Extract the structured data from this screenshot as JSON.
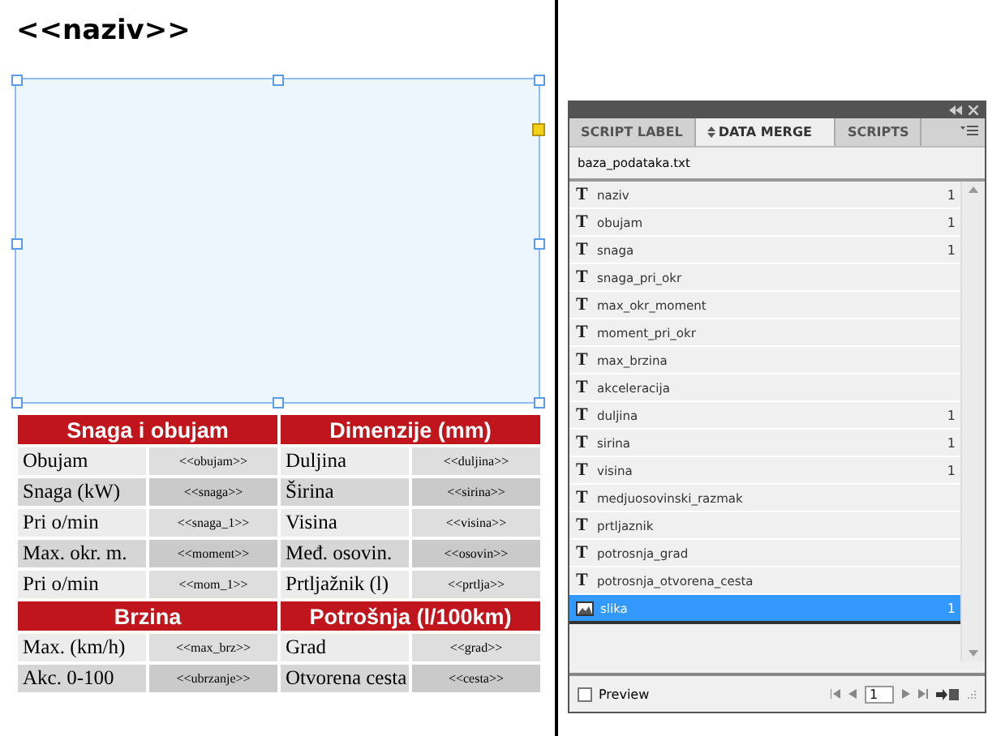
{
  "document": {
    "title": "<<naziv>>",
    "table": {
      "sections": [
        {
          "headers": [
            "Snaga i obujam",
            "Dimenzije (mm)"
          ],
          "rows": [
            [
              "Obujam",
              "<<obujam>>",
              "Duljina",
              "<<duljina>>"
            ],
            [
              "Snaga (kW)",
              "<<snaga>>",
              "Širina",
              "<<sirina>>"
            ],
            [
              "Pri o/min",
              "<<snaga_1>>",
              "Visina",
              "<<visina>>"
            ],
            [
              "Max. okr. m.",
              "<<moment>>",
              "Međ. osovin.",
              "<<osovin>>"
            ],
            [
              "Pri o/min",
              "<<mom_1>>",
              "Prtljažnik (l)",
              "<<prtlja>>"
            ]
          ]
        },
        {
          "headers": [
            "Brzina",
            "Potrošnja (l/100km)"
          ],
          "rows": [
            [
              "Max. (km/h)",
              "<<max_brz>>",
              "Grad",
              "<<grad>>"
            ],
            [
              "Akc. 0-100",
              "<<ubrzanje>>",
              "Otvorena cesta",
              "<<cesta>>"
            ]
          ]
        }
      ]
    }
  },
  "panel": {
    "tabs": [
      {
        "label": "SCRIPT LABEL",
        "selected": false
      },
      {
        "label": "DATA MERGE",
        "selected": true
      },
      {
        "label": "SCRIPTS",
        "selected": false
      }
    ],
    "source": "baza_podataka.txt",
    "fields": [
      {
        "name": "naziv",
        "kind": "text",
        "icon": "T",
        "count": "1",
        "selected": false
      },
      {
        "name": "obujam",
        "kind": "text",
        "icon": "T",
        "count": "1",
        "selected": false
      },
      {
        "name": "snaga",
        "kind": "text",
        "icon": "T",
        "count": "1",
        "selected": false
      },
      {
        "name": "snaga_pri_okr",
        "kind": "text",
        "icon": "T",
        "selected": false
      },
      {
        "name": "max_okr_moment",
        "kind": "text",
        "icon": "T",
        "selected": false
      },
      {
        "name": "moment_pri_okr",
        "kind": "text",
        "icon": "T",
        "selected": false
      },
      {
        "name": "max_brzina",
        "kind": "text",
        "icon": "T",
        "selected": false
      },
      {
        "name": "akceleracija",
        "kind": "text",
        "icon": "T",
        "selected": false
      },
      {
        "name": "duljina",
        "kind": "text",
        "icon": "T",
        "count": "1",
        "selected": false
      },
      {
        "name": "sirina",
        "kind": "text",
        "icon": "T",
        "count": "1",
        "selected": false
      },
      {
        "name": "visina",
        "kind": "text",
        "icon": "T",
        "count": "1",
        "selected": false
      },
      {
        "name": "medjuosovinski_razmak",
        "kind": "text",
        "icon": "T",
        "selected": false
      },
      {
        "name": "prtljaznik",
        "kind": "text",
        "icon": "T",
        "selected": false
      },
      {
        "name": "potrosnja_grad",
        "kind": "text",
        "icon": "T",
        "selected": false
      },
      {
        "name": "potrosnja_otvorena_cesta",
        "kind": "text",
        "icon": "T",
        "selected": false
      },
      {
        "name": "slika",
        "kind": "image",
        "count": "1",
        "selected": true
      }
    ],
    "preview": {
      "label": "Preview",
      "checked": false
    },
    "record": "1"
  }
}
